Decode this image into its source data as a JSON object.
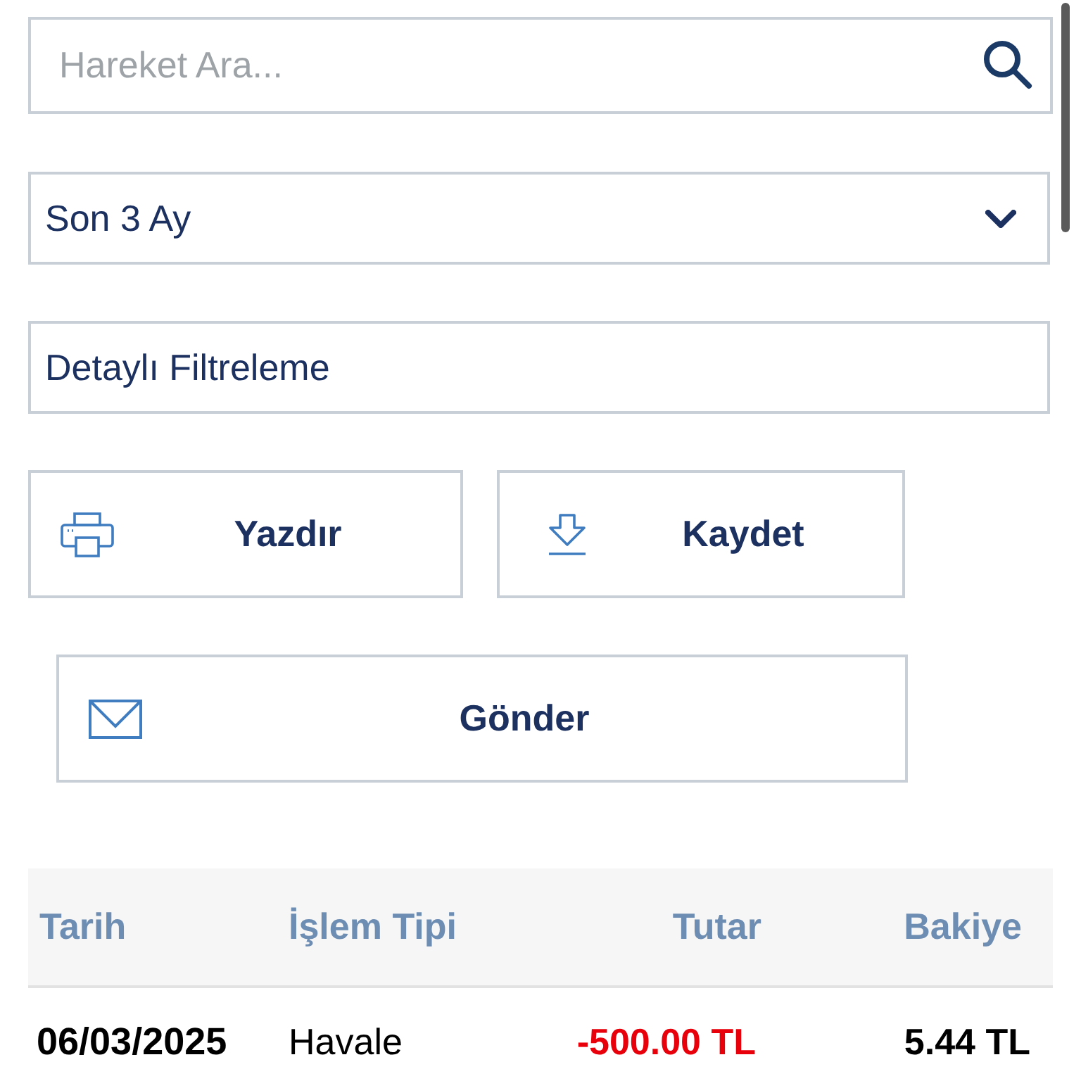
{
  "search": {
    "placeholder": "Hareket Ara..."
  },
  "period_select": {
    "value": "Son 3 Ay"
  },
  "detail_filter": {
    "label": "Detaylı Filtreleme"
  },
  "actions": [
    {
      "kind": "print",
      "label": "Yazdır"
    },
    {
      "kind": "save",
      "label": "Kaydet"
    },
    {
      "kind": "send",
      "label": "Gönder"
    }
  ],
  "table": {
    "columns": [
      "Tarih",
      "İşlem Tipi",
      "Tutar",
      "Bakiye"
    ],
    "rows": [
      {
        "date": "06/03/2025",
        "type": "Havale",
        "amount": "-500.00 TL",
        "negative": true,
        "balance": "5.44 TL"
      }
    ]
  }
}
